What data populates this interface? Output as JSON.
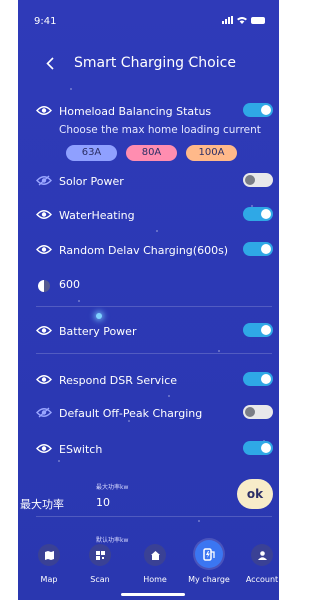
{
  "status_bar": {
    "time": "9:41"
  },
  "header": {
    "back_icon": "chevron-left-icon",
    "title": "Smart Charging Choice"
  },
  "homeload": {
    "label": "Homeload Balancing Status",
    "enabled": true,
    "subtitle": "Choose the max home loading current",
    "options": [
      "63A",
      "80A",
      "100A"
    ]
  },
  "settings": [
    {
      "label": "Solor Power",
      "enabled": false,
      "icon": "eye-slash-icon"
    },
    {
      "label": "WaterHeating",
      "enabled": true,
      "icon": "eye-icon"
    },
    {
      "label": "Random Delav Charging(600s)",
      "enabled": true,
      "icon": "eye-icon"
    }
  ],
  "delay_value": {
    "icon": "half-moon-icon",
    "value": "600"
  },
  "settings2": [
    {
      "label": "Battery Power",
      "enabled": true,
      "icon": "eye-icon"
    },
    {
      "label": "Respond DSR Service",
      "enabled": true,
      "icon": "eye-icon"
    },
    {
      "label": "Default Off-Peak Charging",
      "enabled": false,
      "icon": "eye-slash-icon"
    },
    {
      "label": "ESwitch",
      "enabled": true,
      "icon": "eye-icon"
    }
  ],
  "max_power": {
    "caption": "最大功率kw",
    "label": "最大功率",
    "value": "10"
  },
  "default_power": {
    "caption": "默认功率kw"
  },
  "ok_label": "ok",
  "nav": {
    "items": [
      {
        "label": "Map",
        "icon": "map-icon"
      },
      {
        "label": "Scan",
        "icon": "qr-scan-icon"
      },
      {
        "label": "Home",
        "icon": "home-icon"
      },
      {
        "label": "My charge",
        "icon": "charger-icon",
        "active": true
      },
      {
        "label": "Account",
        "icon": "user-icon"
      }
    ]
  },
  "colors": {
    "background": "#2c39b5",
    "toggle_on": "#2fa8e6",
    "toggle_off": "#e8e8ea",
    "chip_63a": "#8fa0ff",
    "chip_80a": "#ff8db0",
    "chip_100a": "#ffb98a",
    "ok_button": "#f7ecc9",
    "active_nav": "#3b76f2"
  }
}
